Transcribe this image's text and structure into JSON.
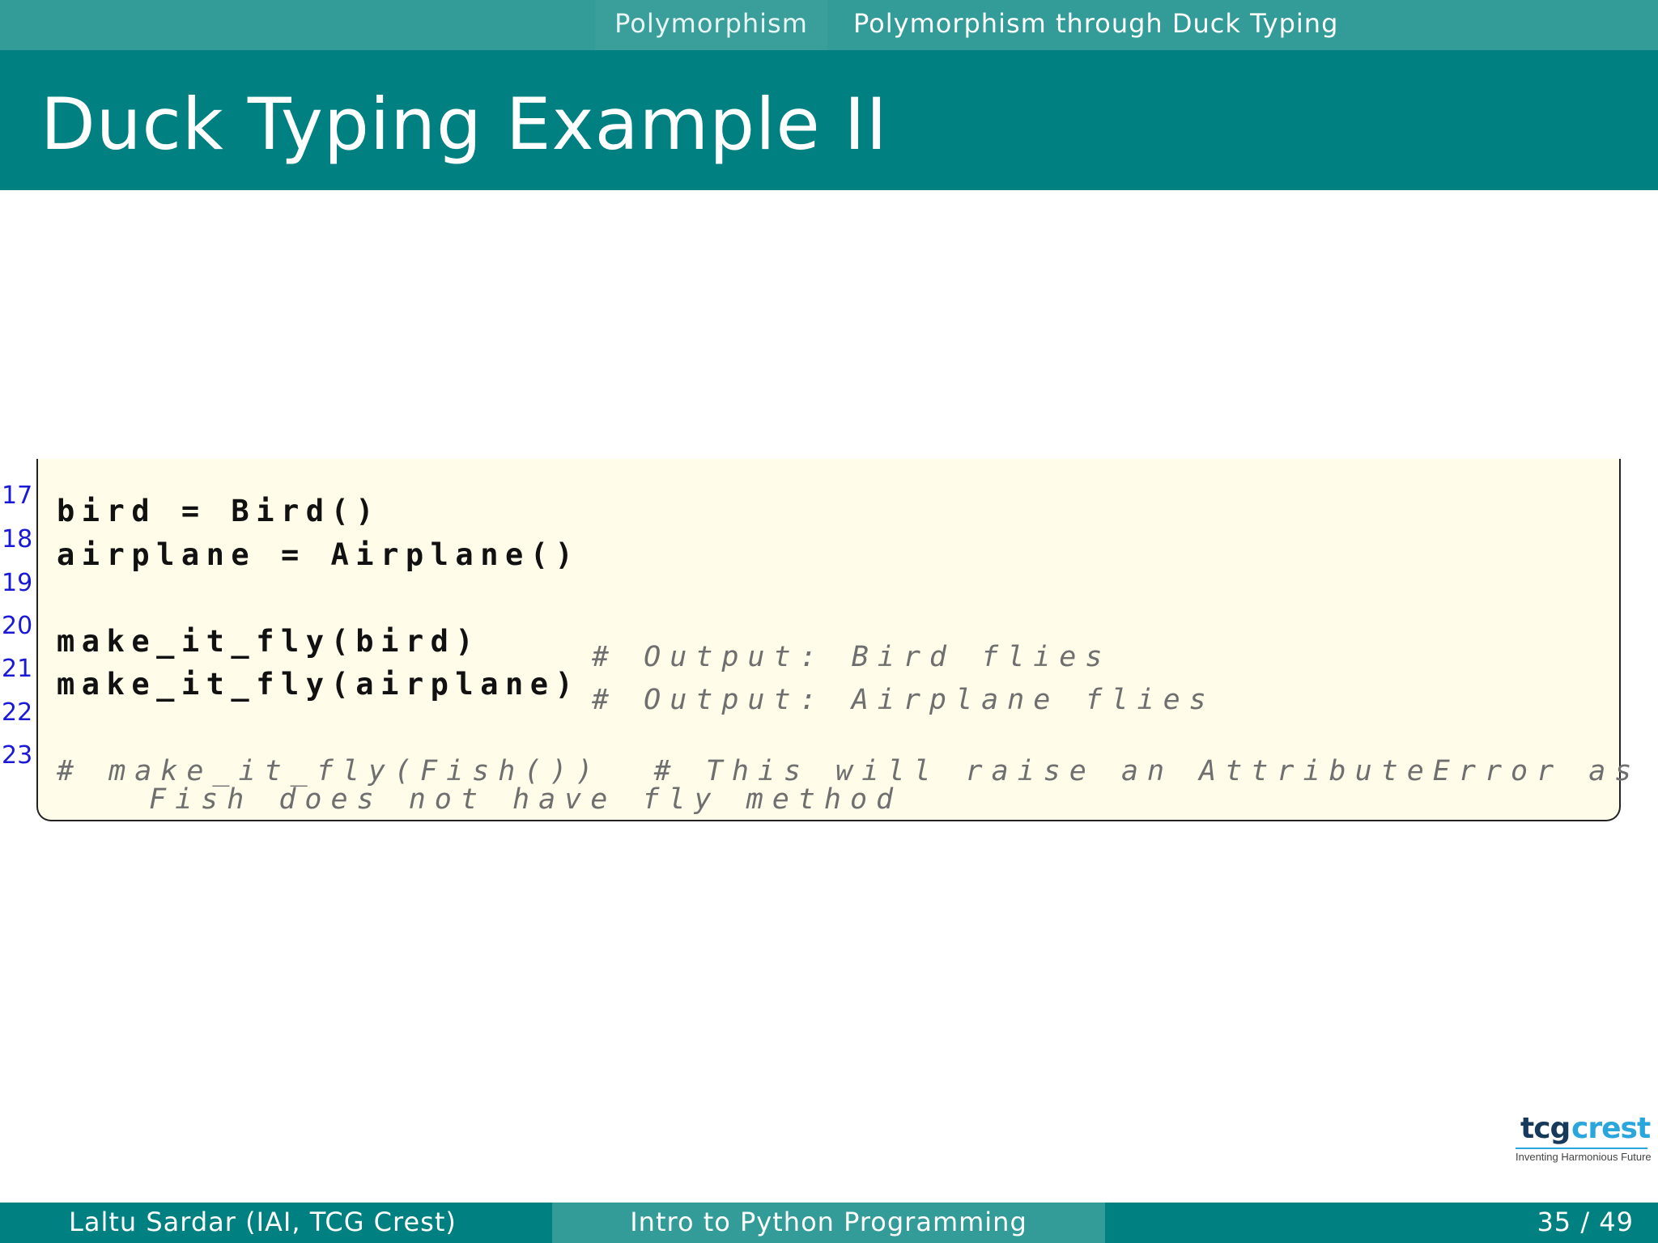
{
  "nav": {
    "section": "Polymorphism",
    "subsection": "Polymorphism through Duck Typing"
  },
  "slide": {
    "title": "Duck Typing Example II"
  },
  "code": {
    "lines": [
      {
        "number": "17",
        "code": "bird = Bird()",
        "comment": "",
        "continuation": ""
      },
      {
        "number": "18",
        "code": "airplane = Airplane()",
        "comment": "",
        "continuation": ""
      },
      {
        "number": "19",
        "code": "",
        "comment": "",
        "continuation": ""
      },
      {
        "number": "20",
        "code": "make_it_fly(bird)",
        "comment": "# Output: Bird flies",
        "continuation": ""
      },
      {
        "number": "21",
        "code": "make_it_fly(airplane)",
        "comment": "# Output: Airplane flies",
        "continuation": ""
      },
      {
        "number": "22",
        "code": "",
        "comment": "",
        "continuation": ""
      },
      {
        "number": "23",
        "code": "",
        "comment": "# make_it_fly(Fish())  # This will raise an AttributeError as",
        "continuation": "Fish does not have fly method"
      }
    ]
  },
  "logo": {
    "tcg": "tcg",
    "crest": "crest",
    "tagline": "Inventing Harmonious Future",
    "colors": {
      "tcg": "#153a5b",
      "crest": "#2aa6dd"
    }
  },
  "footer": {
    "author": "Laltu Sardar  (IAI, TCG Crest)",
    "course": "Intro to Python Programming",
    "page": "35 / 49"
  },
  "theme": {
    "primary": "#008080",
    "secondary": "#339b98",
    "code_background": "#fffcea",
    "line_number_color": "#1a1ad6",
    "comment_color": "#6f6f6f"
  }
}
